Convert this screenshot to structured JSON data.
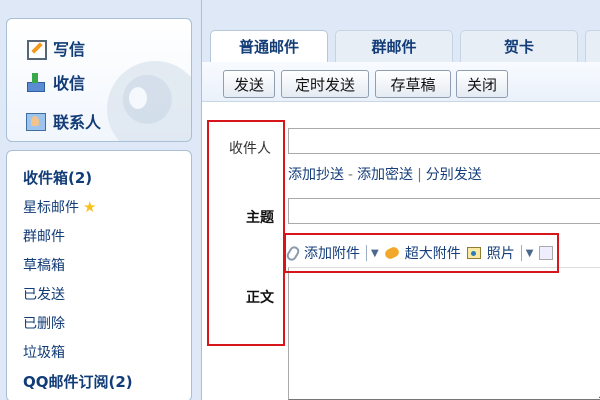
{
  "sidebar": {
    "quick_actions": [
      {
        "label": "写信",
        "icon": "write-icon"
      },
      {
        "label": "收信",
        "icon": "inbox-icon"
      },
      {
        "label": "联系人",
        "icon": "contacts-icon"
      }
    ],
    "folders": [
      {
        "label": "收件箱(2)"
      },
      {
        "label": "星标邮件",
        "icon": "star-icon",
        "icon_glyph": "★"
      },
      {
        "label": "群邮件"
      },
      {
        "label": "草稿箱"
      },
      {
        "label": "已发送"
      },
      {
        "label": "已删除"
      },
      {
        "label": "垃圾箱"
      },
      {
        "label": "QQ邮件订阅(2)"
      }
    ]
  },
  "tabs": [
    {
      "label": "普通邮件"
    },
    {
      "label": "群邮件"
    },
    {
      "label": "贺卡"
    },
    {
      "label": ""
    }
  ],
  "toolbar": {
    "send_label": "发送",
    "scheduled_send_label": "定时发送",
    "save_draft_label": "存草稿",
    "close_label": "关闭"
  },
  "compose": {
    "recipient_label": "收件人",
    "recipient_value": "",
    "cc_link": "添加抄送",
    "bcc_link": "添加密送",
    "separate_send_link": "分别发送",
    "subject_label": "主题",
    "subject_value": "",
    "attach_label": "添加附件",
    "big_attach_label": "超大附件",
    "photo_label": "照片",
    "body_label": "正文",
    "body_value": ""
  },
  "colors": {
    "accent": "#123c77",
    "highlight": "#d7151b",
    "background": "#dfe8f6"
  }
}
